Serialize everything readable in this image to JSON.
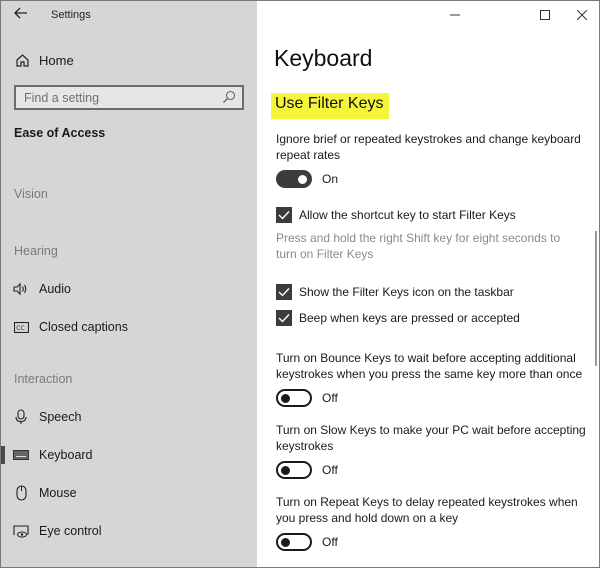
{
  "window": {
    "title": "Settings",
    "controls": {
      "minimize": "minimize",
      "maximize": "maximize",
      "close": "close"
    }
  },
  "sidebar": {
    "home_label": "Home",
    "search": {
      "placeholder": "Find a setting",
      "value": ""
    },
    "current_section": "Ease of Access",
    "groups": [
      {
        "label": "Vision",
        "items": []
      },
      {
        "label": "Hearing",
        "items": [
          {
            "label": "Audio",
            "icon": "speaker-icon",
            "selected": false
          },
          {
            "label": "Closed captions",
            "icon": "closed-captions-icon",
            "selected": false
          }
        ]
      },
      {
        "label": "Interaction",
        "items": [
          {
            "label": "Speech",
            "icon": "microphone-icon",
            "selected": false
          },
          {
            "label": "Keyboard",
            "icon": "keyboard-icon",
            "selected": true
          },
          {
            "label": "Mouse",
            "icon": "mouse-icon",
            "selected": false
          },
          {
            "label": "Eye control",
            "icon": "eye-control-icon",
            "selected": false
          }
        ]
      }
    ]
  },
  "main": {
    "page_title": "Keyboard",
    "section_heading": "Use Filter Keys",
    "highlight_color": "#f5f53a",
    "filter_keys": {
      "description": "Ignore brief or repeated keystrokes and change keyboard repeat rates",
      "toggle_state": "On",
      "toggle_on": true
    },
    "checkboxes": [
      {
        "label": "Allow the shortcut key to start Filter Keys",
        "checked": true
      },
      {
        "label": "Show the Filter Keys icon on the taskbar",
        "checked": true
      },
      {
        "label": "Beep when keys are pressed or accepted",
        "checked": true
      }
    ],
    "shortcut_note": "Press and hold the right Shift key for eight seconds to turn on Filter Keys",
    "bounce_keys": {
      "description": "Turn on Bounce Keys to wait before accepting additional keystrokes when you press the same key more than once",
      "toggle_state": "Off",
      "toggle_on": false
    },
    "slow_keys": {
      "description": "Turn on Slow Keys to make your PC wait before accepting keystrokes",
      "toggle_state": "Off",
      "toggle_on": false
    },
    "repeat_keys": {
      "description": "Turn on Repeat Keys to delay repeated keystrokes when you press and hold down on a key",
      "toggle_state": "Off",
      "toggle_on": false
    }
  }
}
